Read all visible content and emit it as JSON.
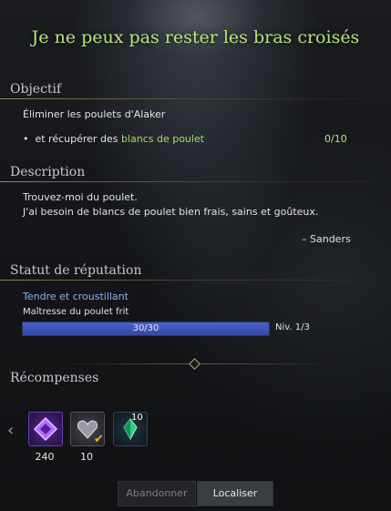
{
  "quest": {
    "title": "Je ne peux pas rester les bras croisés"
  },
  "objective": {
    "heading": "Objectif",
    "main": "Éliminer les poulets d'Alaker",
    "sub_prefix": "et récupérer des",
    "sub_item": "blancs de poulet",
    "progress": "0/10"
  },
  "description": {
    "heading": "Description",
    "line1": "Trouvez-moi du poulet.",
    "line2": "J'ai besoin de blancs de poulet bien frais, sains et goûteux.",
    "author": "– Sanders"
  },
  "reputation": {
    "heading": "Statut de réputation",
    "name": "Tendre et croustillant",
    "rank": "Maîtresse du poulet frit",
    "bar_text": "30/30",
    "bar_fraction": 1.0,
    "level": "Niv. 1/3"
  },
  "rewards": {
    "heading": "Récompenses",
    "items": [
      {
        "icon": "purple-crystal-icon",
        "count": "240"
      },
      {
        "icon": "heart-gem-icon",
        "count": "10"
      },
      {
        "icon": "green-crystal-icon",
        "badge": "10"
      }
    ]
  },
  "buttons": {
    "abandon": "Abandonner",
    "locate": "Localiser"
  },
  "colors": {
    "title": "#b9e37a",
    "highlight": "#a6dc6a",
    "reputation_name": "#8fb3e6",
    "bar": "#3f56bb"
  }
}
